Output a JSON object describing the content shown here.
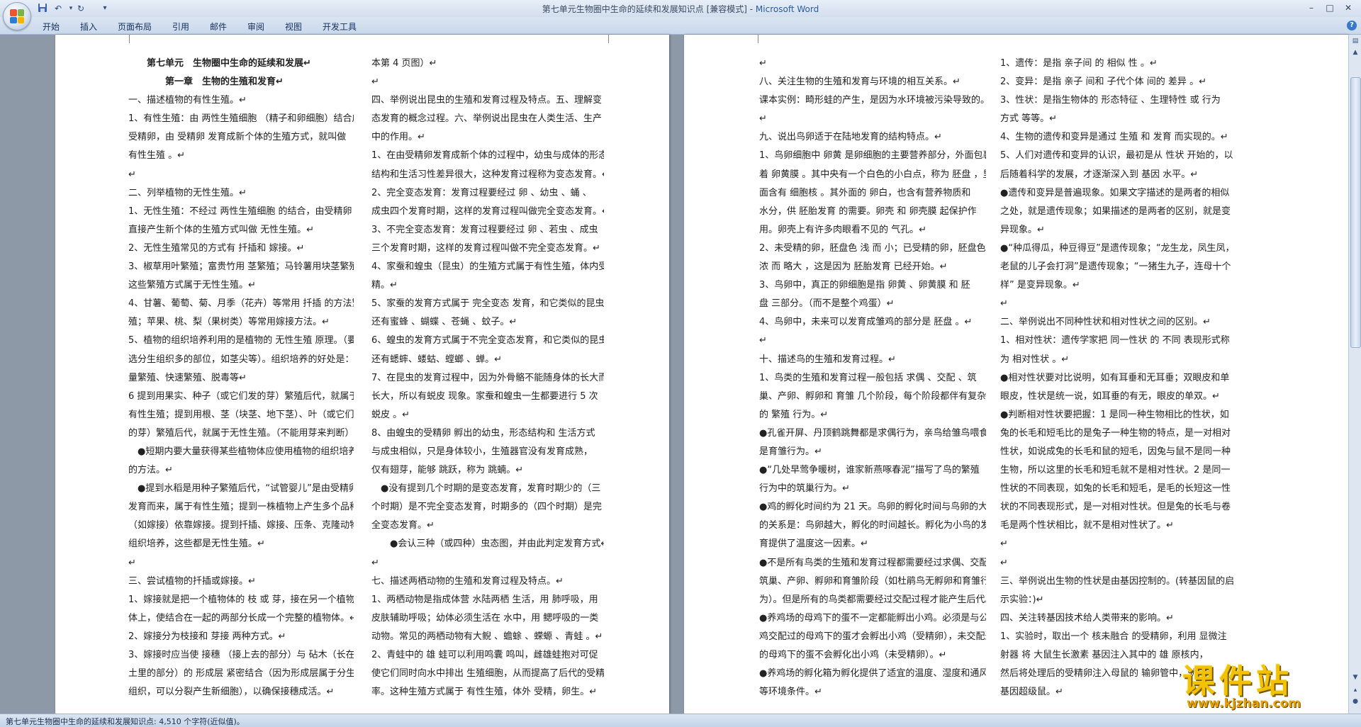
{
  "window": {
    "title": "第七单元生物圈中生命的延续和发展知识点 [兼容模式] - Microsoft Word",
    "title_doc": "第七单元生物圈中生命的延续和发展知识点 [兼容模式] - ",
    "title_app": "Microsoft Word"
  },
  "qat": {
    "save_icon": "save-icon",
    "undo_glyph": "↶",
    "redo_glyph": "↻",
    "customize_glyph": "▾"
  },
  "controls": {
    "min": "–",
    "max": "□",
    "close": "✕",
    "help": "?"
  },
  "ribbon": {
    "tabs": [
      "开始",
      "插入",
      "页面布局",
      "引用",
      "邮件",
      "审阅",
      "视图",
      "开发工具"
    ]
  },
  "status": {
    "text": "第七单元生物圈中生命的延续和发展知识点: 4,510 个字符(近似值)。"
  },
  "watermark": {
    "title": "课件站",
    "url": "www.kjzhan.com"
  },
  "page1": {
    "col1": [
      "　　第七单元　生物圈中生命的延续和发展↵",
      "　　　　第一章　生物的生殖和发育↵",
      "一、描述植物的有性生殖。↵",
      "1、有性生殖：由 两性生殖细胞 （精子和卵细胞）结合成",
      "受精卵，由 受精卵 发育成新个体的生殖方式，就叫做",
      "有性生殖 。↵",
      "↵",
      "二、列举植物的无性生殖。↵",
      "1、无性生殖：不经过 两性生殖细胞 的结合，由受精卵",
      "直接产生新个体的生殖方式叫做 无性生殖。↵",
      "2、无性生殖常见的方式有 扦插和 嫁接。↵",
      "3、椒草用叶繁殖；富贵竹用 茎繁殖；马铃薯用块茎繁殖，",
      "这些繁殖方式属于无性生殖。↵",
      "4、甘薯、葡萄、菊、月季（花卉）等常用 扦插 的方法繁",
      "殖；苹果、桃、梨（果树类）等常用嫁接方法。↵",
      "5、植物的组织培养利用的是植物的 无性生殖 原理。（要",
      "选分生组织多的部位，如茎尖等）。组织培养的好处是：大",
      "量繁殖、快速繁殖、脱毒等↵",
      "6 提到用果实、种子（或它们发的芽）繁殖后代，就属于",
      "有性生殖；提到用根、茎（块茎、地下茎）、叶（或它们发",
      "的芽）繁殖后代，就属于无性生殖。（不能用芽来判断）↵",
      "　●短期内要大量获得某些植物体应使用植物的组织培养",
      "的方法。↵",
      "　●提到水稻是用种子繁殖后代，“试管婴儿”是由受精卵",
      "发育而来，属于有性生殖；提到一株植物上产生多个品种，",
      "（如嫁接）依靠嫁接。提到扦插、嫁接、压条、克隆动物、",
      "组织培养，这些都是无性生殖。↵",
      "↵",
      "三、尝试植物的扦插或嫁接。↵",
      "1、嫁接就是把一个植物体的 枝 或 芽，接在另一个植物",
      "体上，使结合在一起的两部分长成一个完整的植物体。↵",
      "2、嫁接分为枝接和 芽接 两种方式。↵",
      "3、嫁接时应当使 接穗 （接上去的部分）与 砧木（长在",
      "土里的部分）的 形成层 紧密结合（因为形成层属于分生",
      "组织，可以分裂产生新细胞），以确保接穗成活。↵"
    ],
    "col2": [
      "本第 4 页图）↵",
      "↵",
      "四、举例说出昆虫的生殖和发育过程及特点。五、理解变",
      "态发育的概念过程。六、举例说出昆虫在人类生活、生产",
      "中的作用。↵",
      "1、在由受精卵发育成新个体的过程中，幼虫与成体的形态",
      "结构和生活习性差异很大，这种发育过程称为变态发育。↵",
      "2、完全变态发育：发育过程要经过 卵 、幼虫 、蛹 、",
      "成虫四个发育时期，这样的发育过程叫做完全变态发育。↵",
      "3、不完全变态发育：发育过程要经过 卵 、若虫 、成虫",
      "三个发育时期，这样的发育过程叫做不完全变态发育。↵",
      "4、家蚕和蝗虫（昆虫）的生殖方式属于有性生殖，体内受",
      "精。↵",
      "5、家蚕的发育方式属于 完全变态 发育，和它类似的昆虫",
      "还有蜜蜂 、蝴蝶 、苍蝇 、蚊子。↵",
      "6、蝗虫的发育方式属于不完全变态发育，和它类似的昆虫",
      "还有蟋蟀、蝼蛄、螳螂 、蝉。↵",
      "7、在昆虫的发育过程中，因为外骨骼不能随身体的长大而",
      "长大，所以有蜕皮 现象。家蚕和蝗虫一生都要进行 5 次",
      "蜕皮 。↵",
      "8、由蝗虫的受精卵 孵出的幼虫，形态结构和 生活方式",
      "与成虫相似，只是身体较小，生殖器官没有发育成熟，",
      "仅有翅芽，能够 跳跃，称为 跳蝻。↵",
      "　●没有提到几个时期的是变态发育，发育时期少的（三",
      "个时期）是不完全变态发育，时期多的（四个时期）是完",
      "全变态发育。↵",
      "　　●会认三种（或四种）虫态图，并由此判定发育方式↵",
      "↵",
      "七、描述两栖动物的生殖和发育过程及特点。↵",
      "1、两栖动物是指成体营 水陆两栖 生活，用 肺呼吸，用",
      "皮肤辅助呼吸；幼体必须生活在 水中，用 鳃呼吸的一类",
      "动物。常见的两栖动物有大鲵 、蟾蜍 、蝾螈 、青蛙 。↵",
      "2、青蛙中的 雄 蛙可以利用鸣囊 鸣叫，雌雄蛙抱对可促",
      "使它们同时向水中排出 生殖细胞，从而提高了后代的受精",
      "率。这种生殖方式属于 有性生殖，体外 受精，卵生。↵"
    ]
  },
  "page2": {
    "col1": [
      "↵",
      "八、关注生物的生殖和发育与环境的相互关系。↵",
      "课本实例：畸形蛙的产生，是因为水环境被污染导致的。↵",
      "↵",
      "九、说出鸟卵适于在陆地发育的结构特点。↵",
      "1、鸟卵细胞中 卵黄 是卵细胞的主要营养部分，外面包裹",
      "着 卵黄膜 。其中央有一个白色的小白点，称为 胚盘 ，里",
      "面含有 细胞核 。其外面的 卵白，也含有营养物质和",
      "水分，供 胚胎发育 的需要。卵壳 和 卵壳膜 起保护作",
      "用。卵壳上有许多肉眼看不见的 气孔。↵",
      "2、未受精的卵，胚盘色 浅 而 小；已受精的卵，胚盘色",
      " 浓 而 略大 ，这是因为 胚胎发育 已经开始。↵",
      "3、鸟卵中，真正的卵细胞是指 卵黄 、卵黄膜 和 胚",
      "盘 三部分。（而不是整个鸡蛋）↵",
      "4、鸟卵中，未来可以发育成雏鸡的部分是 胚盘 。↵",
      "↵",
      "十、描述鸟的生殖和发育过程。↵",
      "1、鸟类的生殖和发育过程一般包括 求偶 、交配 、筑",
      "巢、产卵、孵卵和 育雏 几个阶段，每个阶段都伴有复杂",
      "的 繁殖 行为。↵",
      "●孔雀开屏、丹顶鹤跳舞都是求偶行为，亲鸟给雏鸟喂食",
      "是育雏行为。↵",
      "●“几处早莺争暖树，谁家新燕啄春泥”描写了鸟的繁殖",
      "行为中的筑巢行为。↵",
      "●鸡的孵化时间约为 21 天。鸟卵的孵化时间与鸟卵的大小",
      "的关系是：鸟卵越大，孵化的时间越长。孵化为小鸟的发",
      "育提供了温度这一因素。↵",
      "●不是所有鸟类的生殖和发育过程都需要经过求偶、交配、",
      "筑巢、产卵、孵卵和育雏阶段（如杜鹃鸟无孵卵和育雏行",
      "为）。但是所有的鸟类都需要经过交配过程才能产生后代。↵",
      "●养鸡场的母鸡下的蛋不一定都能孵出小鸡。必须是与公",
      "鸡交配过的母鸡下的蛋才会孵出小鸡（受精卵），未交配过",
      "的母鸡下的蛋不会孵化出小鸡（未受精卵）。↵",
      "●养鸡场的孵化箱为孵化提供了适宜的温度、湿度和通风",
      "等环境条件。↵"
    ],
    "col2": [
      "1、遗传：是指 亲子间 的 相似 性 。↵",
      "2、变异：是指 亲子 间和 子代个体 间的 差异 。↵",
      "3、性状：是指生物体的 形态特征 、生理特性 或 行为",
      "方式 等等。↵",
      "4、生物的遗传和变异是通过 生殖 和 发育 而实现的。↵",
      "5、人们对遗传和变异的认识，最初是从 性状 开始的，以",
      "后随着科学的发展，才逐渐深入到 基因 水平。↵",
      "●遗传和变异是普遍现象。如果文字描述的是两者的相似",
      "之处，就是遗传现象；如果描述的是两者的区别，就是变",
      "异现象。↵",
      "●“种瓜得瓜，种豆得豆”是遗传现象；“龙生龙，凤生凤，",
      "老鼠的儿子会打洞”是遗传现象；“一猪生九子，连母十个",
      "样” 是变异现象。↵",
      "↵",
      "二、举例说出不同种性状和相对性状之间的区别。↵",
      "1、相对性状：遗传学家把 同一性状 的 不同 表现形式称",
      "为 相对性状 。↵",
      "●相对性状要对比说明，如有耳垂和无耳垂；双眼皮和单",
      "眼皮，性状是统一说，如耳垂的有无，眼皮的单双。↵",
      "●判断相对性状要把握：1 是同一种生物相比的性状，如",
      "兔的长毛和短毛比的是兔子一种生物的特点，是一对相对",
      "性状，如说成兔的长毛和鼠的短毛，因兔与鼠不是同一种",
      "生物，所以这里的长毛和短毛就不是相对性状。2 是同一",
      "性状的不同表现，如兔的长毛和短毛，是毛的长短这一性",
      "状的不同表现形式，是一对相对性状。但是兔的长毛与卷",
      "毛是两个性状相比，就不是相对性状了。↵",
      "↵",
      "↵",
      "三、举例说出生物的性状是由基因控制的。(转基因鼠的启",
      "示实验：)↵",
      "四、关注转基因技术给人类带来的影响。↵",
      "1、实验时，取出一个 核未融合 的受精卵，利用 显微注",
      "射器 将 大鼠生长激素 基因注入其中的 雄 原核内，",
      "然后将处理后的受精卵注入母鼠的 输卵管中，就 会",
      "基因超级鼠。↵"
    ]
  }
}
